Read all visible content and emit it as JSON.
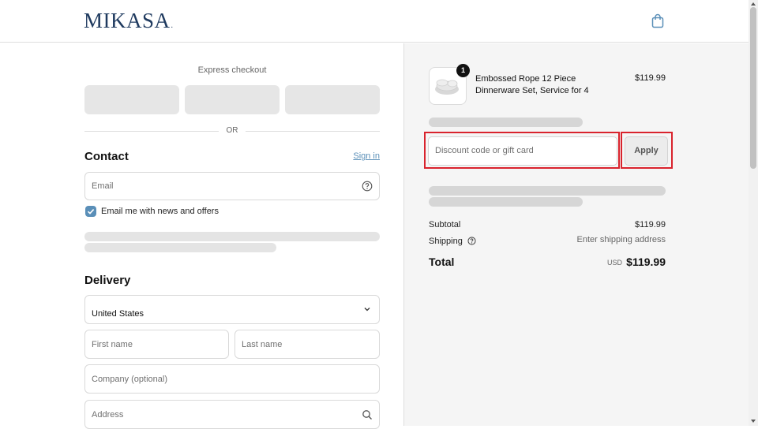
{
  "brand": {
    "logo_text": "MIKASA",
    "logo_mark": "."
  },
  "header": {
    "cart_icon": "shopping-bag-icon"
  },
  "express": {
    "title": "Express checkout",
    "or_text": "OR"
  },
  "contact": {
    "title": "Contact",
    "sign_in": "Sign in",
    "email_placeholder": "Email",
    "help_icon": "question-circle-icon",
    "newsletter_label": "Email me with news and offers",
    "newsletter_checked": true
  },
  "delivery": {
    "title": "Delivery",
    "country_value": "United States",
    "first_name_placeholder": "First name",
    "last_name_placeholder": "Last name",
    "company_placeholder": "Company (optional)",
    "address_placeholder": "Address",
    "search_icon": "search-icon"
  },
  "order": {
    "product_name": "Embossed Rope 12 Piece Dinnerware Set, Service for 4",
    "product_price": "$119.99",
    "quantity": "1",
    "discount_placeholder": "Discount code or gift card",
    "apply_label": "Apply",
    "subtotal_label": "Subtotal",
    "subtotal_value": "$119.99",
    "shipping_label": "Shipping",
    "shipping_value": "Enter shipping address",
    "total_label": "Total",
    "total_currency": "USD",
    "total_value": "$119.99"
  },
  "colors": {
    "accent": "#5a8fb8",
    "brand": "#1f3a5f",
    "highlight": "#d9232d",
    "summary_bg": "#f5f5f5"
  }
}
